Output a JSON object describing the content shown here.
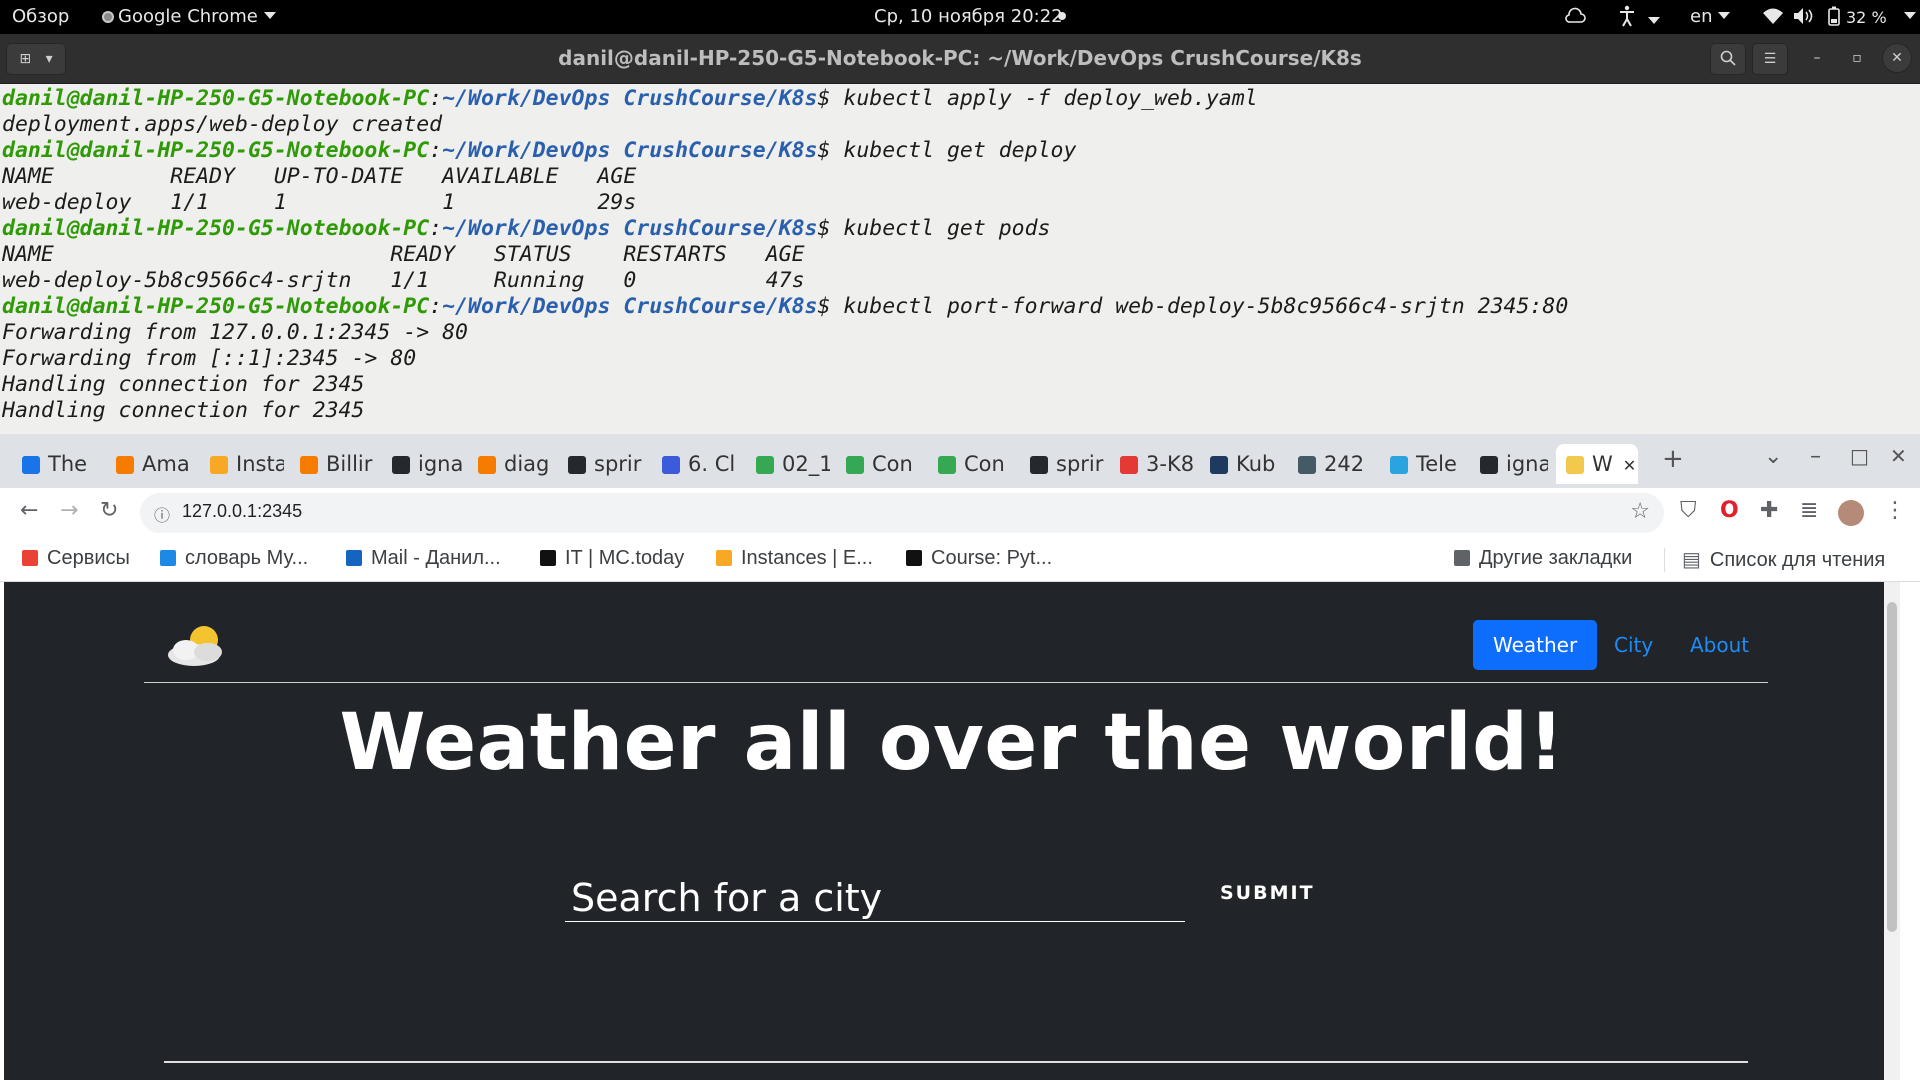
{
  "topbar": {
    "activities": "Обзор",
    "app_name": "Google Chrome",
    "datetime": "Ср, 10 ноября  20:22",
    "language": "en",
    "battery": "32 %"
  },
  "terminal": {
    "title": "danil@danil-HP-250-G5-Notebook-PC: ~/Work/DevOps CrushCourse/K8s",
    "prompt_user": "danil@danil-HP-250-G5-Notebook-PC",
    "prompt_path": "~/Work/DevOps CrushCourse/K8s",
    "lines": [
      {
        "type": "cmd",
        "text": "kubectl apply -f deploy_web.yaml"
      },
      {
        "type": "out",
        "text": "deployment.apps/web-deploy created"
      },
      {
        "type": "cmd",
        "text": "kubectl get deploy"
      },
      {
        "type": "out",
        "text": "NAME         READY   UP-TO-DATE   AVAILABLE   AGE"
      },
      {
        "type": "out",
        "text": "web-deploy   1/1     1            1           29s"
      },
      {
        "type": "cmd",
        "text": "kubectl get pods"
      },
      {
        "type": "out",
        "text": "NAME                          READY   STATUS    RESTARTS   AGE"
      },
      {
        "type": "out",
        "text": "web-deploy-5b8c9566c4-srjtn   1/1     Running   0          47s"
      },
      {
        "type": "cmd",
        "text": "kubectl port-forward web-deploy-5b8c9566c4-srjtn 2345:80"
      },
      {
        "type": "out",
        "text": "Forwarding from 127.0.0.1:2345 -> 80"
      },
      {
        "type": "out",
        "text": "Forwarding from [::1]:2345 -> 80"
      },
      {
        "type": "out",
        "text": "Handling connection for 2345"
      },
      {
        "type": "out",
        "text": "Handling connection for 2345"
      }
    ]
  },
  "browser": {
    "tabs": [
      {
        "label": "The",
        "color": "#1a73e8"
      },
      {
        "label": "Ama",
        "color": "#f57c00"
      },
      {
        "label": "Insta",
        "color": "#f9a825"
      },
      {
        "label": "Billir",
        "color": "#f57c00"
      },
      {
        "label": "igna",
        "color": "#24292e"
      },
      {
        "label": "diag",
        "color": "#f57c00"
      },
      {
        "label": "sprir",
        "color": "#24292e"
      },
      {
        "label": "6. Cl",
        "color": "#3b5bdb"
      },
      {
        "label": "02_1",
        "color": "#34a853"
      },
      {
        "label": "Con",
        "color": "#34a853"
      },
      {
        "label": "Con",
        "color": "#34a853"
      },
      {
        "label": "sprir",
        "color": "#24292e"
      },
      {
        "label": "3-K8",
        "color": "#e53935"
      },
      {
        "label": "Kub",
        "color": "#1e3a5f"
      },
      {
        "label": "242",
        "color": "#455a64"
      },
      {
        "label": "Tele",
        "color": "#2aa3df"
      },
      {
        "label": "igna",
        "color": "#24292e"
      },
      {
        "label": "W",
        "color": "#f2c94c",
        "active": true
      }
    ],
    "url": "127.0.0.1:2345",
    "bookmarks": [
      {
        "label": "Сервисы",
        "color": "#ea4335"
      },
      {
        "label": "словарь Му...",
        "color": "#1e88e5"
      },
      {
        "label": "Mail - Данил...",
        "color": "#1565c0"
      },
      {
        "label": "IT | MC.today",
        "color": "#111111"
      },
      {
        "label": "Instances | E...",
        "color": "#f9a825"
      },
      {
        "label": "Course: Pyt...",
        "color": "#111111"
      }
    ],
    "other_bookmarks": "Другие закладки",
    "reading_list": "Список для чтения"
  },
  "page": {
    "nav": {
      "weather": "Weather",
      "city": "City",
      "about": "About"
    },
    "hero_title": "Weather all over the world!",
    "search_placeholder": "Search for a city",
    "submit_label": "SUBMIT",
    "colors": {
      "background": "#212529",
      "accent": "#0d6efd",
      "link": "#1d8cf8"
    }
  }
}
